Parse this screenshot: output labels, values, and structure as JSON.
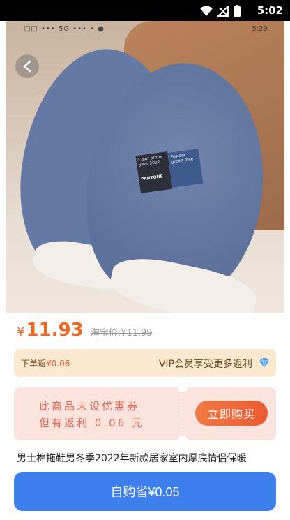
{
  "status_bar": {
    "time": "5:02"
  },
  "inner_status": {
    "left": "□□ ••• 5G ••• • ●",
    "right": "5:29"
  },
  "product": {
    "price_currency": "¥",
    "price": "11.93",
    "taobao_price": "淘宝价:¥11.99",
    "title": "男士棉拖鞋男冬季2022年新款居家室内厚底情侣保暖",
    "tag_1": "Color of the year 2022",
    "tag_1_brand": "PANTONE",
    "tag_2": "Powder green rose"
  },
  "rebate": {
    "label": "下单返",
    "amount": "¥0.06",
    "vip_text": "VIP会员享受更多返利"
  },
  "coupon": {
    "line1": "此商品未设优惠券",
    "line2": "但有返利 0.06 元",
    "buy_label": "立即购买"
  },
  "self_buy": {
    "label": "自购省¥0.05"
  },
  "colors": {
    "accent": "#f2661f",
    "primary": "#3e7ff0"
  }
}
